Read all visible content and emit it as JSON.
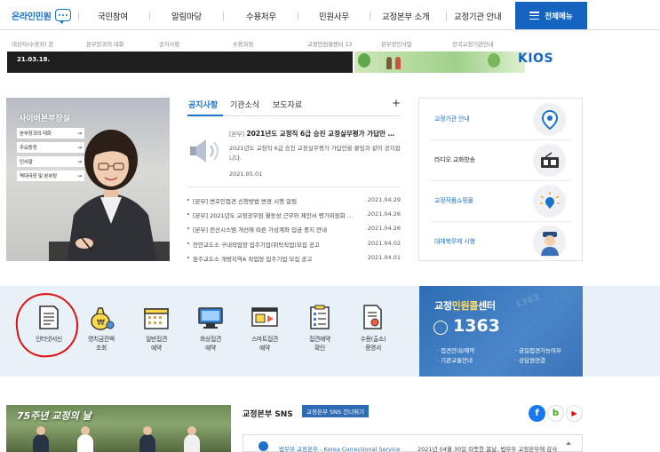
{
  "nav": {
    "online": "온라인민원",
    "items": [
      "국민참여",
      "알림마당",
      "수용처우",
      "민원사무",
      "교정본부 소개",
      "교정기관 안내"
    ],
    "all_menu": "전체메뉴"
  },
  "subnav": [
    "대상자(수용자) 관",
    "본부장과의 대화",
    "공지사항",
    "수용과정",
    "교정민원콜센터 13",
    "본부장인사말",
    "전국교정기관안내"
  ],
  "banner": {
    "date": "21.03.18.",
    "brand": "KIOS"
  },
  "cyber": {
    "title": "사이버본부장실",
    "links": [
      "본부장과의 대화",
      "주요동정",
      "인사말",
      "역대국장 및 본부장"
    ]
  },
  "notice": {
    "tabs": [
      "공지사항",
      "기관소식",
      "보도자료"
    ],
    "plus": "+",
    "featured": {
      "tag": "[본부]",
      "title": "2021년도 교정직 6급 승진 교정실무평가 가답안 …",
      "desc": "2021년도 교정직 6급 승진 교정실무평가 가답안을 붙임과 같이 공지합니다.",
      "date": "2021.05.01"
    },
    "items": [
      {
        "title": "[본부] 변호인접견 신청방법 변경 시행 알림",
        "date": "2021.04.29"
      },
      {
        "title": "[본부] 2021년도 교정공무원 월동성 근무와 제안서 평가위원회 …",
        "date": "2021.04.26"
      },
      {
        "title": "[본부] 전산시스템 개선에 따른 가상계좌 입금 중지 안내",
        "date": "2021.04.26"
      },
      {
        "title": "천안교도소 구내작업장 입주기업(위탁작업)모집 공고",
        "date": "2021.04.02"
      },
      {
        "title": "원주교도소 개방지역A 작업장 입주기업 모집 공고",
        "date": "2021.04.01"
      }
    ]
  },
  "quick": [
    {
      "label": "교정기관 안내",
      "icon": "location-pin-icon"
    },
    {
      "label": "라디오 교화방송",
      "icon": "radio-icon"
    },
    {
      "label": "교정작품쇼핑몰",
      "icon": "shopping-icon"
    },
    {
      "label": "대체복무제 시행",
      "icon": "officer-icon"
    }
  ],
  "services": [
    {
      "line1": "인터넷서신",
      "line2": "",
      "icon": "letter-icon"
    },
    {
      "line1": "영치금잔액",
      "line2": "조회",
      "icon": "money-bag-icon"
    },
    {
      "line1": "일반접견",
      "line2": "예약",
      "icon": "calendar-icon"
    },
    {
      "line1": "화상접견",
      "line2": "예약",
      "icon": "monitor-icon"
    },
    {
      "line1": "스마트접견",
      "line2": "예약",
      "icon": "smart-visit-icon"
    },
    {
      "line1": "접견예약",
      "line2": "확인",
      "icon": "checklist-icon"
    },
    {
      "line1": "수용(출소)",
      "line2": "증명서",
      "icon": "certificate-icon"
    }
  ],
  "callcenter": {
    "title_a": "교정",
    "title_b": "민원콜",
    "title_c": "센터",
    "number": "1363",
    "watermark": "1363",
    "items": [
      "· 접견안내/예약",
      "· 금일접견가능여부",
      "· 기관교통안내",
      "· 상담원연결"
    ]
  },
  "anniversary": {
    "title": "75주년 교정의 날"
  },
  "sns": {
    "title": "교정본부 SNS",
    "button": "교정본부 SNS 건너뛰기",
    "account": "법무부 교정본부 - Korea Correctional Service",
    "post": "2021년 04월 30일 따뜻한 봄날, 법무부 교정본부에 감사",
    "fb": "f",
    "blog": "b",
    "yt": "▶"
  },
  "colors": {
    "accent": "#1a73c9",
    "navy": "#1565c0",
    "band": "#e8f1f8",
    "highlight": "#e01010"
  }
}
